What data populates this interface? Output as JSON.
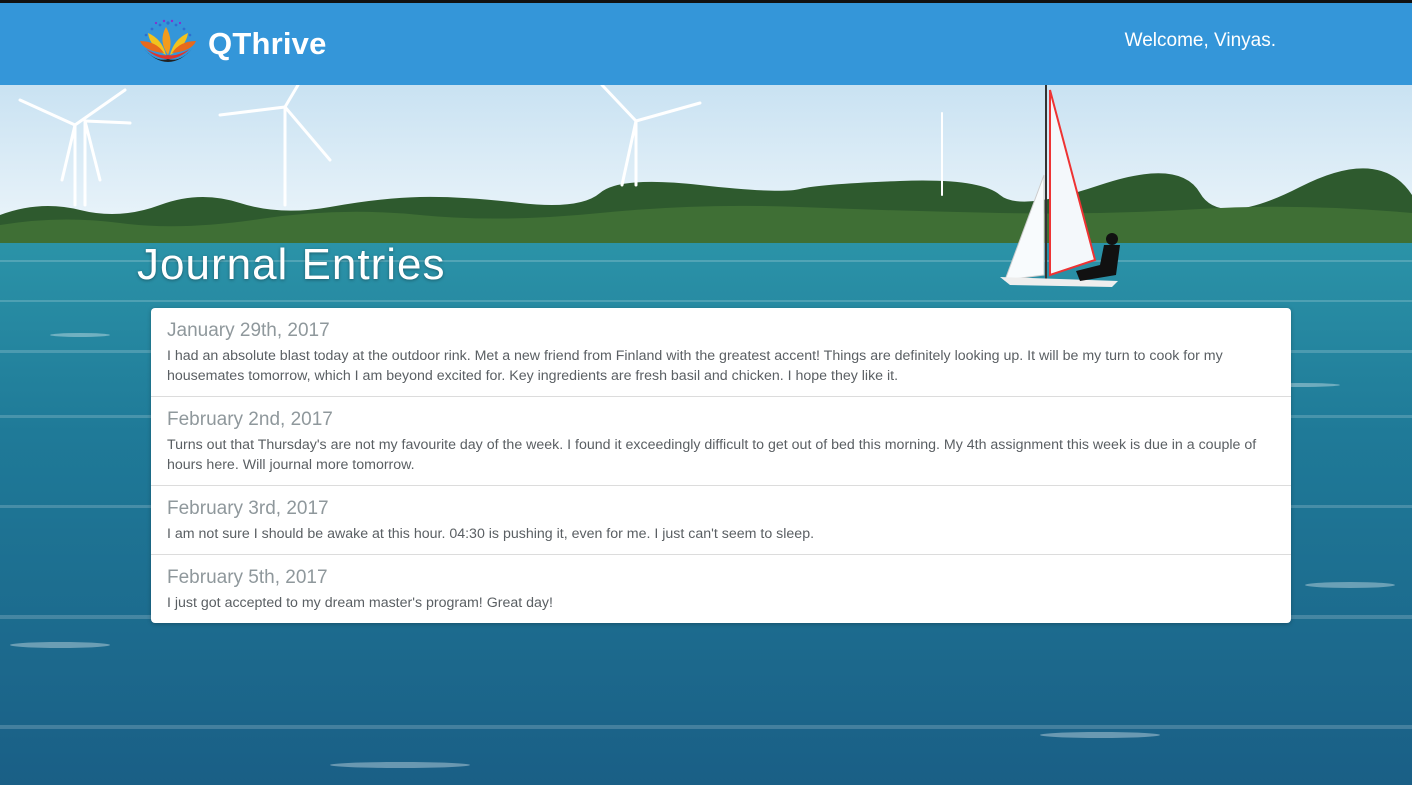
{
  "navbar": {
    "brand": "QThrive",
    "welcome": "Welcome, Vinyas."
  },
  "icons": {
    "logo": "lotus-logo-icon"
  },
  "colors": {
    "navbar": "#3496d9",
    "title": "#ffffff",
    "entry_date": "#8f989c",
    "entry_text": "#5a5f63"
  },
  "page": {
    "title": "Journal Entries"
  },
  "entries": [
    {
      "date": "January 29th, 2017",
      "text": "I had an absolute blast today at the outdoor rink. Met a new friend from Finland with the greatest accent! Things are definitely looking up. It will be my turn to cook for my housemates tomorrow, which I am beyond excited for. Key ingredients are fresh basil and chicken. I hope they like it."
    },
    {
      "date": "February 2nd, 2017",
      "text": "Turns out that Thursday's are not my favourite day of the week. I found it exceedingly difficult to get out of bed this morning. My 4th assignment this week is due in a couple of hours here. Will journal more tomorrow."
    },
    {
      "date": "February 3rd, 2017",
      "text": "I am not sure I should be awake at this hour. 04:30 is pushing it, even for me. I just can't seem to sleep."
    },
    {
      "date": "February 5th, 2017",
      "text": "I just got accepted to my dream master's program! Great day!"
    }
  ]
}
